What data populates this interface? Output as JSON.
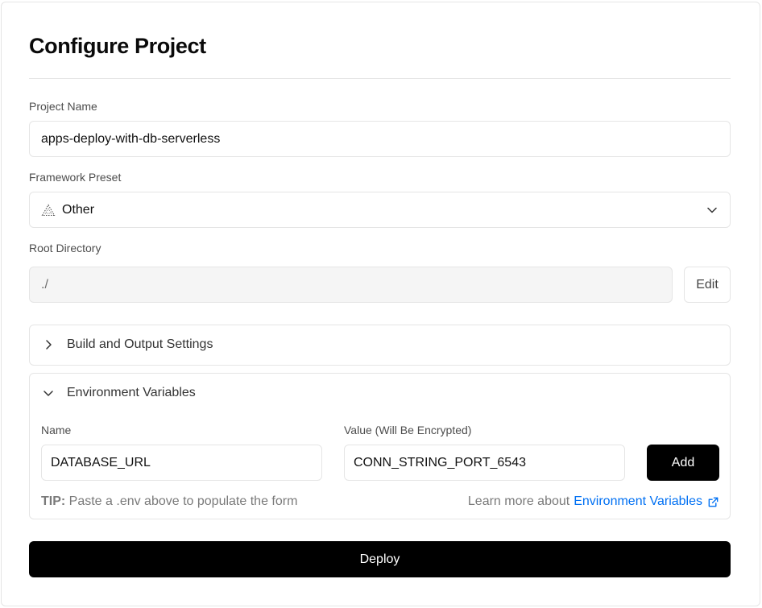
{
  "header": {
    "title": "Configure Project"
  },
  "project_name": {
    "label": "Project Name",
    "value": "apps-deploy-with-db-serverless"
  },
  "framework": {
    "label": "Framework Preset",
    "value": "Other",
    "icon": "triangle-warning-icon"
  },
  "root_directory": {
    "label": "Root Directory",
    "value": "./",
    "edit_label": "Edit"
  },
  "build_settings": {
    "label": "Build and Output Settings",
    "icon": "chevron-right-icon"
  },
  "env_vars": {
    "label": "Environment Variables",
    "icon": "chevron-down-icon",
    "name_label": "Name",
    "value_label": "Value (Will Be Encrypted)",
    "name_value": "DATABASE_URL",
    "value_value": "CONN_STRING_PORT_6543",
    "add_label": "Add",
    "tip_prefix": "TIP:",
    "tip_text": " Paste a .env above to populate the form",
    "learn_prefix": "Learn more about",
    "learn_link": "Environment Variables"
  },
  "deploy": {
    "label": "Deploy"
  },
  "colors": {
    "accent": "#0070f3",
    "primary_button": "#000000",
    "border": "#e5e5e5"
  }
}
